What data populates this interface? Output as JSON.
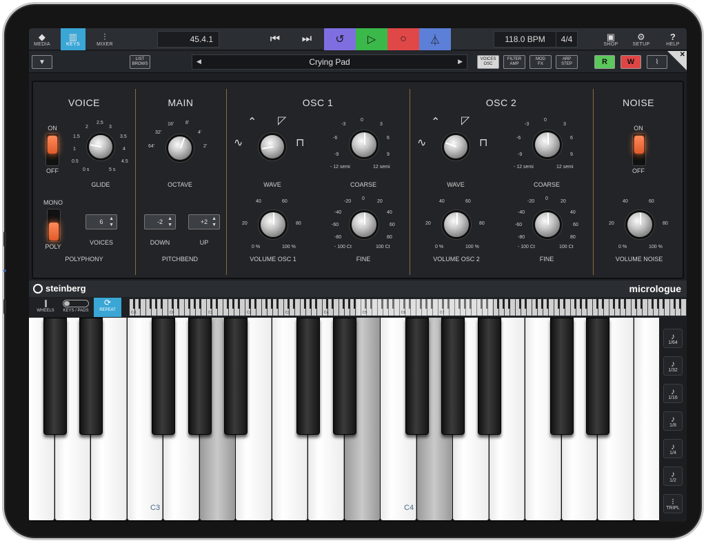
{
  "topbar": {
    "media": "MEDIA",
    "keys": "KEYS",
    "mixer": "MIXER",
    "position": "45.4.1",
    "tempo": "118.0 BPM",
    "signature": "4/4",
    "shop": "SHOP",
    "setup": "SETUP",
    "help": "HELP",
    "colors": {
      "cycle": "#7e6ee0",
      "play": "#3bb84a",
      "record": "#e04848",
      "metronome": "#5c7fd8",
      "keys_active": "#3aa6d6"
    }
  },
  "secondbar": {
    "list_browse": [
      "LIST",
      "BROWS"
    ],
    "preset": "Crying Pad",
    "tabs": [
      {
        "l1": "VOICES",
        "l2": "OSC"
      },
      {
        "l1": "FILTER",
        "l2": "AMP"
      },
      {
        "l1": "MOD",
        "l2": "FX"
      },
      {
        "l1": "ARP",
        "l2": "STEP"
      }
    ],
    "read": "R",
    "write": "W"
  },
  "synth": {
    "voice": {
      "title": "VOICE",
      "on": "ON",
      "off": "OFF",
      "glide": "GLIDE",
      "glide_ticks": [
        "2",
        "2.5",
        "3",
        "1.5",
        "3.5",
        "1",
        "4",
        "0.5",
        "4.5",
        "0 s",
        "5 s"
      ],
      "mono": "MONO",
      "poly": "POLY",
      "voices_value": "6",
      "voices": "VOICES",
      "polyphony": "POLYPHONY"
    },
    "main": {
      "title": "MAIN",
      "octave": "OCTAVE",
      "octave_ticks": [
        "16'",
        "8'",
        "32'",
        "4'",
        "64'",
        "2'"
      ],
      "down_value": "-2",
      "up_value": "+2",
      "down": "DOWN",
      "up": "UP",
      "pitchbend": "PITCHBEND"
    },
    "osc1": {
      "title": "OSC 1",
      "wave": "WAVE",
      "coarse": "COARSE",
      "coarse_ticks": [
        "0",
        "-3",
        "3",
        "-6",
        "6",
        "-9",
        "9",
        "- 12 semi",
        "12 semi"
      ],
      "volume": "VOLUME OSC 1",
      "vol_ticks": [
        "40",
        "60",
        "20",
        "80",
        "0 %",
        "100 %"
      ],
      "fine": "FINE",
      "fine_ticks": [
        "0",
        "-20",
        "20",
        "-40",
        "40",
        "-60",
        "60",
        "-80",
        "80",
        "- 100 Ct",
        "100 Ct"
      ]
    },
    "osc2": {
      "title": "OSC 2",
      "wave": "WAVE",
      "coarse": "COARSE",
      "coarse_ticks": [
        "0",
        "-3",
        "3",
        "-6",
        "6",
        "-9",
        "9",
        "- 12 semi",
        "12 semi"
      ],
      "volume": "VOLUME OSC 2",
      "vol_ticks": [
        "40",
        "60",
        "20",
        "80",
        "0 %",
        "100 %"
      ],
      "fine": "FINE",
      "fine_ticks": [
        "0",
        "-20",
        "20",
        "-40",
        "40",
        "-60",
        "60",
        "-80",
        "80",
        "- 100 Ct",
        "100 Ct"
      ]
    },
    "noise": {
      "title": "NOISE",
      "on": "ON",
      "off": "OFF",
      "volume": "VOLUME NOISE",
      "vol_ticks": [
        "40",
        "60",
        "20",
        "80",
        "0 %",
        "100 %"
      ]
    }
  },
  "brand": {
    "company": "steinberg",
    "product": "micrologue"
  },
  "kbbar": {
    "wheels": "WHEELS",
    "keys_pads": "KEYS / PADS",
    "repeat": "REPEAT",
    "repeat_color": "#3aa6d6"
  },
  "keyboard": {
    "c3": "C3",
    "c4": "C4",
    "mini_labels": [
      "C-1",
      "C0",
      "C1",
      "C2",
      "C3",
      "C4",
      "C5",
      "C6",
      "C7"
    ]
  },
  "note_repeat": [
    "1/64",
    "1/32",
    "1/16",
    "1/8",
    "1/4",
    "1/2",
    "TRIPL"
  ]
}
